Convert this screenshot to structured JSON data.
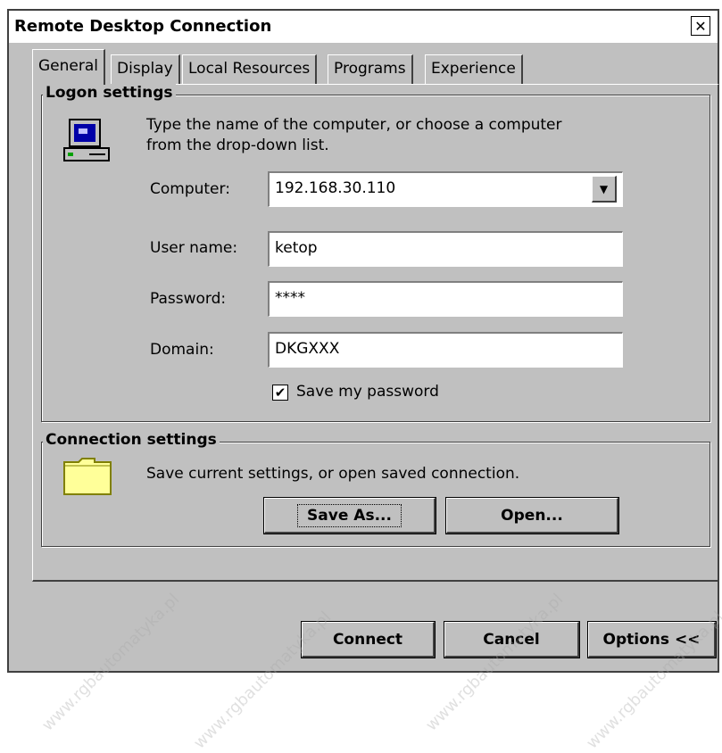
{
  "window": {
    "title": "Remote Desktop Connection",
    "close_glyph": "✕"
  },
  "tabs": [
    {
      "label": "General",
      "active": true
    },
    {
      "label": "Display",
      "active": false
    },
    {
      "label": "Local Resources",
      "active": false
    },
    {
      "label": "Programs",
      "active": false
    },
    {
      "label": "Experience",
      "active": false
    }
  ],
  "logon": {
    "legend": "Logon settings",
    "description_line1": "Type the name of the computer, or choose a computer",
    "description_line2": "from the drop-down list.",
    "computer_label": "Computer:",
    "computer_value": "192.168.30.110",
    "username_label": "User name:",
    "username_value": "ketop",
    "password_label": "Password:",
    "password_value": "****",
    "domain_label": "Domain:",
    "domain_value": "DKGXXX",
    "save_password_label": "Save my password",
    "save_password_checked": true,
    "check_glyph": "✔",
    "dropdown_glyph": "▼"
  },
  "connection": {
    "legend": "Connection settings",
    "description": "Save current settings, or open saved connection.",
    "save_as_label": "Save As...",
    "open_label": "Open..."
  },
  "footer": {
    "connect_label": "Connect",
    "cancel_label": "Cancel",
    "options_label": "Options <<"
  },
  "watermark": "www.rgbautomatyka.pl"
}
